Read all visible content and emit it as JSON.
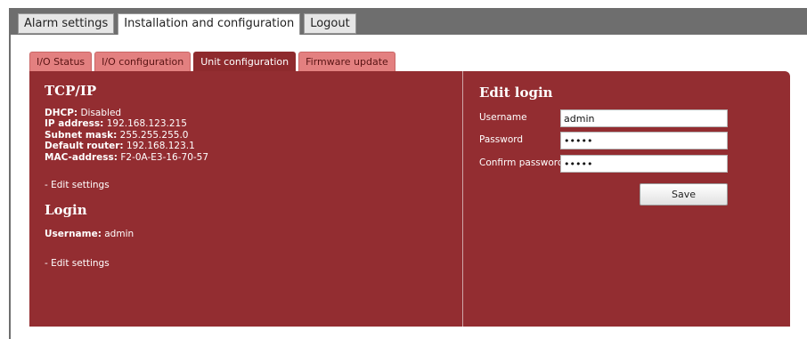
{
  "main_tabs": {
    "alarm_settings": "Alarm settings",
    "installation": "Installation and configuration",
    "logout": "Logout",
    "active": "installation"
  },
  "sub_tabs": {
    "io_status": "I/O Status",
    "io_configuration": "I/O configuration",
    "unit_configuration": "Unit configuration",
    "firmware_update": "Firmware update",
    "active": "unit_configuration"
  },
  "tcpip": {
    "title": "TCP/IP",
    "dhcp_label": "DHCP:",
    "dhcp_value": "Disabled",
    "ip_label": "IP address:",
    "ip_value": "192.168.123.215",
    "subnet_label": "Subnet mask:",
    "subnet_value": "255.255.255.0",
    "router_label": "Default router:",
    "router_value": "192.168.123.1",
    "mac_label": "MAC-address:",
    "mac_value": "F2-0A-E3-16-70-57",
    "edit_link": "- Edit settings"
  },
  "login": {
    "title": "Login",
    "username_label": "Username:",
    "username_value": "admin",
    "edit_link": "- Edit settings"
  },
  "edit_login": {
    "title": "Edit login",
    "username_label": "Username",
    "username_value": "admin",
    "password_label": "Password",
    "password_value": "•••••",
    "confirm_label": "Confirm password",
    "confirm_value": "•••••",
    "save_label": "Save"
  },
  "colors": {
    "panel": "#932d31",
    "inactive_subtab": "#e38080",
    "top_bar": "#6e6e6e"
  }
}
